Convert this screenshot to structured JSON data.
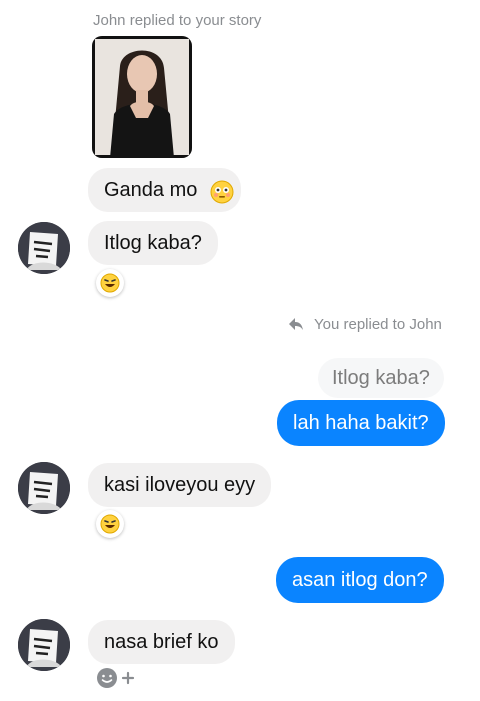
{
  "story": {
    "reply_header": "John replied to your story"
  },
  "messages": [
    {
      "id": "m1",
      "text": "Ganda mo",
      "emoji_after": "flushed"
    },
    {
      "id": "m2",
      "text": "Itlog kaba?",
      "reaction": "laughing-face"
    },
    {
      "id": "m3",
      "text": "kasi iloveyou eyy",
      "reaction": "laughing-face"
    },
    {
      "id": "m4",
      "text": "nasa brief ko",
      "reaction": "add-reaction"
    }
  ],
  "my_reply": {
    "header": "You replied to John",
    "quoted_text": "Itlog kaba?",
    "reply_text": "lah haha bakit?"
  },
  "outgoing": [
    {
      "id": "o1",
      "text": "asan itlog don?"
    }
  ],
  "colors": {
    "incoming_bubble": "#f1f0f0",
    "outgoing_bubble": "#0a84ff",
    "meta_text": "#8a8d91"
  }
}
